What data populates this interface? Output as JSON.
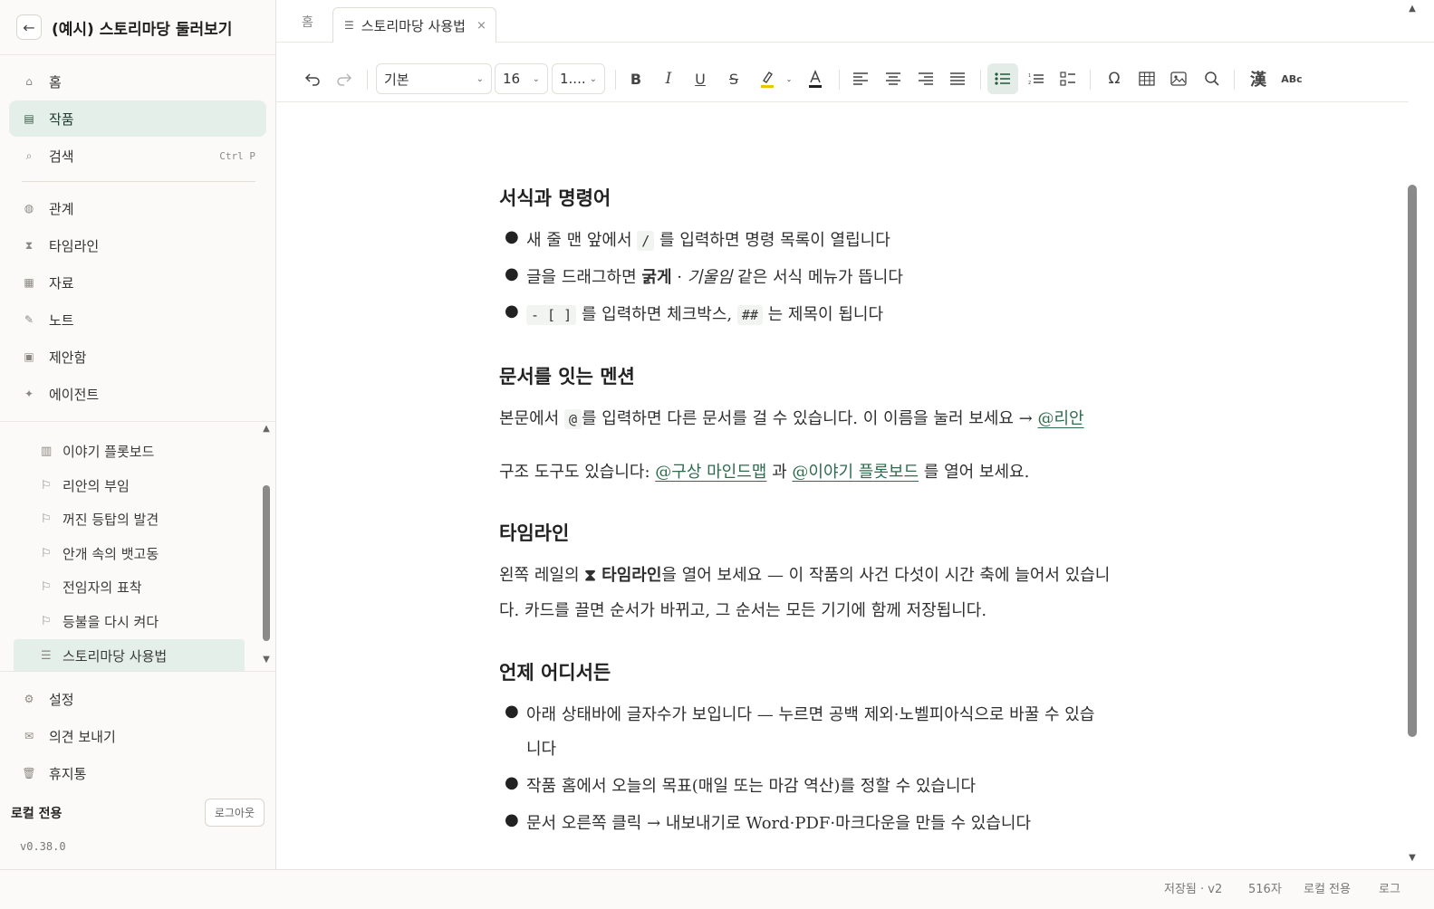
{
  "sidebar": {
    "title": "(예시) 스토리마당 둘러보기",
    "back_icon": "←",
    "nav_top": [
      {
        "label": "홈",
        "icon": "⌂"
      },
      {
        "label": "작품",
        "icon": "▤",
        "active": true
      },
      {
        "label": "검색",
        "icon": "⌕",
        "shortcut": "Ctrl P"
      }
    ],
    "nav_mid": [
      {
        "label": "관계",
        "icon": "◍"
      },
      {
        "label": "타임라인",
        "icon": "⧗"
      },
      {
        "label": "자료",
        "icon": "▦"
      },
      {
        "label": "노트",
        "icon": "✎"
      },
      {
        "label": "제안함",
        "icon": "▣"
      },
      {
        "label": "에이전트",
        "icon": "✦"
      }
    ],
    "tree": [
      {
        "label": "이야기 플롯보드",
        "icon": "▥"
      },
      {
        "label": "리안의 부임",
        "icon": "⚐"
      },
      {
        "label": "꺼진 등탑의 발견",
        "icon": "⚐"
      },
      {
        "label": "안개 속의 뱃고동",
        "icon": "⚐"
      },
      {
        "label": "전임자의 표착",
        "icon": "⚐"
      },
      {
        "label": "등불을 다시 켜다",
        "icon": "⚐"
      },
      {
        "label": "스토리마당 사용법",
        "icon": "☰",
        "active": true
      }
    ],
    "nav_bottom": [
      {
        "label": "설정",
        "icon": "⚙"
      },
      {
        "label": "의견 보내기",
        "icon": "✉"
      },
      {
        "label": "휴지통",
        "icon": "🗑"
      }
    ],
    "local_only": "로컬 전용",
    "logout": "로그아웃",
    "version": "v0.38.0"
  },
  "tabs": {
    "home": "홈",
    "doc": "스토리마당 사용법",
    "close": "×"
  },
  "toolbar": {
    "style_select": "기본",
    "size_select": "16",
    "line_select": "1....",
    "buttons": [
      "undo-icon",
      "redo-icon",
      "bold-icon",
      "italic-icon",
      "underline-icon",
      "strikethrough-icon",
      "highlight-icon",
      "font-color-icon",
      "align-left-icon",
      "align-center-icon",
      "align-right-icon",
      "align-justify-icon",
      "bullet-list-icon",
      "ordered-list-icon",
      "checklist-icon",
      "special-char-icon",
      "table-icon",
      "image-icon",
      "search-icon",
      "hanja-icon",
      "spellcheck-icon"
    ],
    "hanja": "漢",
    "spellcheck": "ABc",
    "accent_color": "#2d6b4d",
    "highlight_color": "#f2c200"
  },
  "document": {
    "s1_title": "서식과 명령어",
    "s1_b1_pre": "새 줄 맨 앞에서",
    "s1_b1_code": "/",
    "s1_b1_post": "를 입력하면 명령 목록이 열립니다",
    "s1_b2_pre": "글을 드래그하면",
    "s1_b2_bold": "굵게",
    "s1_b2_mid": "·",
    "s1_b2_italic": "기울임",
    "s1_b2_post": "같은 서식 메뉴가 뜹니다",
    "s1_b3_code1": "- [ ]",
    "s1_b3_mid": "를 입력하면 체크박스,",
    "s1_b3_code2": "##",
    "s1_b3_post": "는 제목이 됩니다",
    "s2_title": "문서를 잇는 멘션",
    "s2_p1_pre": "본문에서",
    "s2_p1_code": "@",
    "s2_p1_post": "를 입력하면 다른 문서를 걸 수 있습니다. 이 이름을 눌러 보세요 →",
    "s2_p1_link": "@리안",
    "s2_p2_pre": "구조 도구도 있습니다:",
    "s2_p2_link1": "@구상 마인드맵",
    "s2_p2_mid": "과",
    "s2_p2_link2": "@이야기 플롯보드",
    "s2_p2_post": "를 열어 보세요.",
    "s3_title": "타임라인",
    "s3_p_pre": "왼쪽 레일의",
    "s3_p_bold": "⧗ 타임라인",
    "s3_p_post": "을 열어 보세요 — 이 작품의 사건 다섯이 시간 축에 늘어서 있습니",
    "s3_p_line2": "다. 카드를 끌면 순서가 바뀌고, 그 순서는 모든 기기에 함께 저장됩니다.",
    "s4_title": "언제 어디서든",
    "s4_b1_line1": "아래 상태바에 글자수가 보입니다 — 누르면 공백 제외·노벨피아식으로 바꿀 수 있습",
    "s4_b1_line2": "니다",
    "s4_b2": "작품 홈에서 오늘의 목표(매일 또는 마감 역산)를 정할 수 있습니다",
    "s4_b3": "문서 오른쪽 클릭 → 내보내기로 Word·PDF·마크다운을 만들 수 있습니다"
  },
  "status": {
    "saved": "저장됨 · v2",
    "chars": "516자",
    "local": "로컬 전용",
    "log": "로그"
  }
}
